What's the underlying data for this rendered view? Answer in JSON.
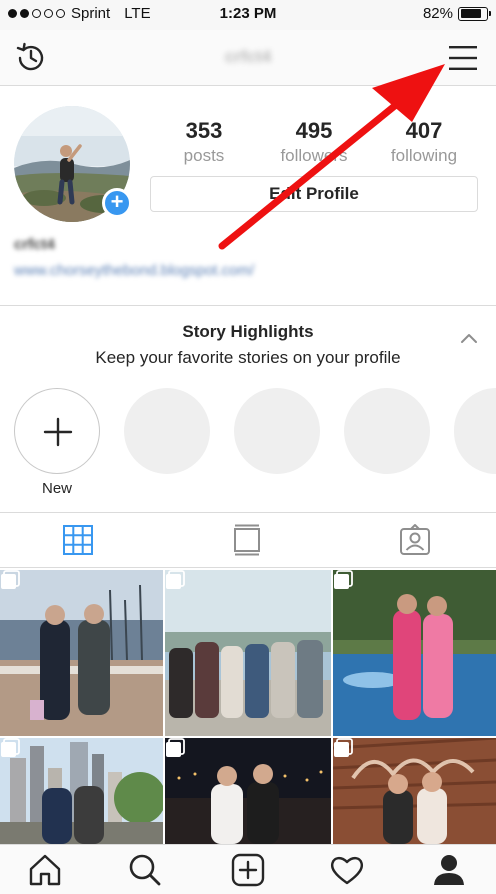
{
  "status_bar": {
    "carrier": "Sprint",
    "network": "LTE",
    "time": "1:23 PM",
    "battery_text": "82%",
    "battery_level": 0.82
  },
  "nav": {
    "username": "crfct4",
    "left_icon": "history-icon",
    "right_icon": "menu-icon"
  },
  "profile": {
    "stats": [
      {
        "count": "353",
        "label": "posts"
      },
      {
        "count": "495",
        "label": "followers"
      },
      {
        "count": "407",
        "label": "following"
      }
    ],
    "edit_button_label": "Edit Profile",
    "display_name": "crfct4",
    "website": "www.chorseythebond.blogspot.com/"
  },
  "highlights": {
    "title": "Story Highlights",
    "subtitle": "Keep your favorite stories on your profile",
    "new_label": "New"
  },
  "tabs": [
    "grid-icon",
    "feed-icon",
    "tagged-icon"
  ],
  "bottom_nav": [
    "home-icon",
    "search-icon",
    "add-post-icon",
    "heart-icon",
    "profile-icon"
  ],
  "colors": {
    "accent": "#3897f0",
    "annotation_arrow": "#ee1111",
    "divider": "#dbdbdb"
  }
}
